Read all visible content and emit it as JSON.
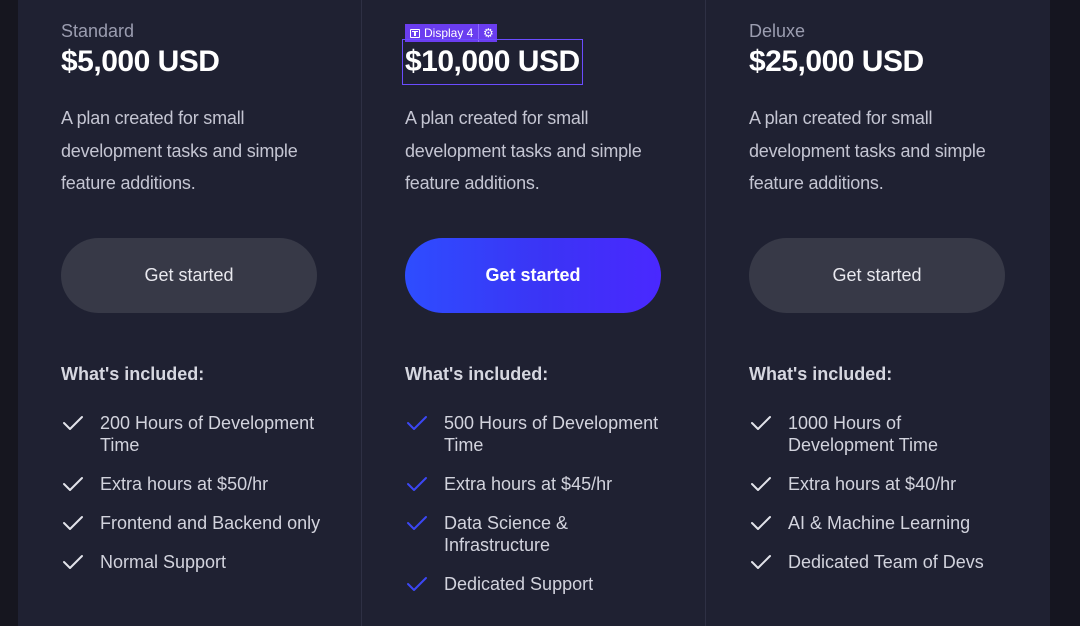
{
  "plans": [
    {
      "name": "Standard",
      "price": "$5,000 USD",
      "description": "A plan created for small development tasks and simple feature additions.",
      "cta_label": "Get started",
      "included_title": "What's included:",
      "features": [
        "200 Hours of Development Time",
        "Extra hours at $50/hr",
        "Frontend and Backend only",
        "Normal Support"
      ]
    },
    {
      "name": "",
      "price": "$10,000 USD",
      "description": "A plan created for small development tasks and simple feature additions.",
      "cta_label": "Get started",
      "included_title": "What's included:",
      "features": [
        "500 Hours of Development Time",
        "Extra hours at $45/hr",
        "Data Science & Infrastructure",
        "Dedicated Support"
      ]
    },
    {
      "name": "Deluxe",
      "price": "$25,000 USD",
      "description": "A plan created for small development tasks and simple feature additions.",
      "cta_label": "Get started",
      "included_title": "What's included:",
      "features": [
        "1000 Hours of Development Time",
        "Extra hours at $40/hr",
        "AI & Machine Learning",
        "Dedicated Team of Devs"
      ]
    }
  ],
  "editor_tag": {
    "label": "Display 4",
    "icon": "text-box-icon",
    "settings_icon": "gear-icon",
    "color": "#6a3df0"
  },
  "colors": {
    "card_background": "#1f2132",
    "primary_gradient_start": "#2e4dff",
    "primary_gradient_end": "#4a28ff",
    "secondary_button": "#373947",
    "check_default": "#e2e3ea",
    "check_highlight": "#3b47f5"
  }
}
